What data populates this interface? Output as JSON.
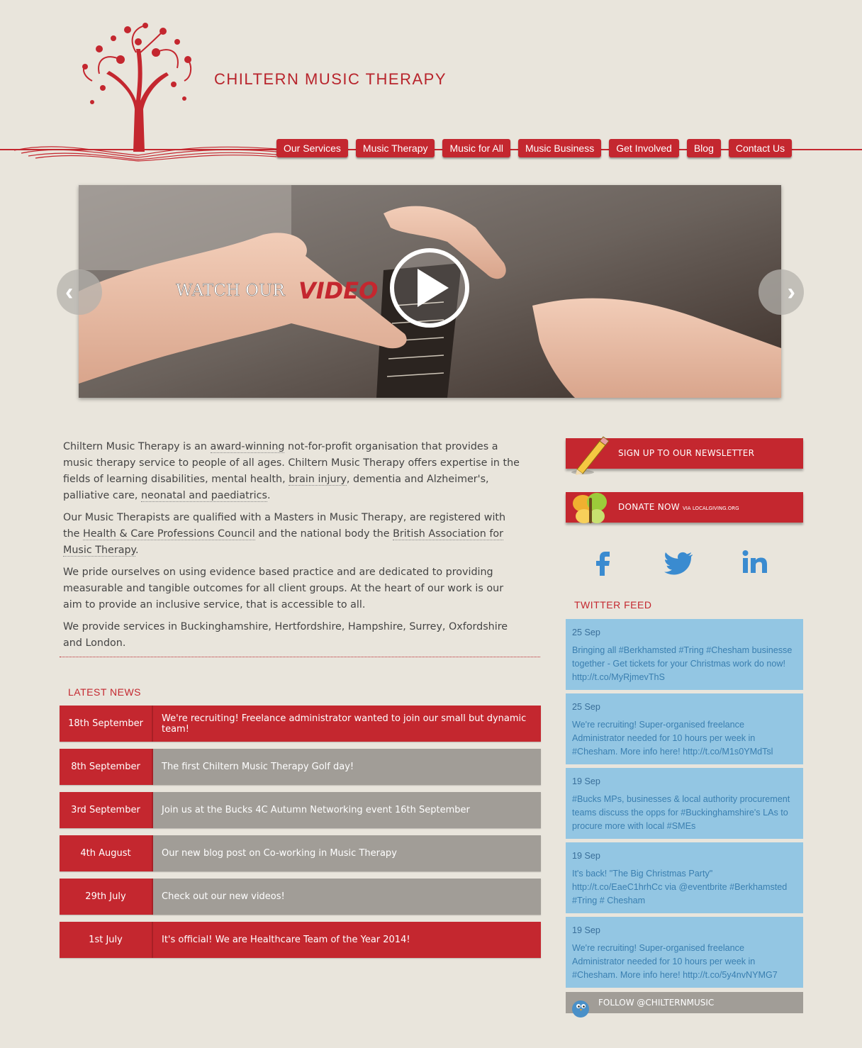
{
  "site": {
    "title": "CHILTERN MUSIC THERAPY"
  },
  "nav": [
    {
      "label": "Our Services"
    },
    {
      "label": "Music Therapy"
    },
    {
      "label": "Music for All"
    },
    {
      "label": "Music Business"
    },
    {
      "label": "Get Involved"
    },
    {
      "label": "Blog"
    },
    {
      "label": "Contact Us"
    }
  ],
  "slider": {
    "watch_label": "WATCH OUR",
    "video_label": "VIDEO",
    "prev": "‹",
    "next": "›"
  },
  "intro": {
    "p1_a": "Chiltern Music Therapy is an ",
    "p1_link1": "award-winning",
    "p1_b": " not-for-profit organisation that provides a music therapy service to people of all ages. Chiltern Music Therapy offers expertise in the fields of learning disabilities, mental health, ",
    "p1_link2": "brain injury",
    "p1_c": ", dementia and Alzheimer's, palliative care, ",
    "p1_link3": "neonatal and paediatrics",
    "p1_d": ".",
    "p2_a": "Our Music Therapists are qualified with a Masters in Music Therapy, are registered with the ",
    "p2_link1": "Health & Care Professions Council",
    "p2_b": " and the national body the ",
    "p2_link2": "British Association for Music Therapy",
    "p2_c": ".",
    "p3": "We pride ourselves on using evidence based practice and are dedicated to providing measurable and tangible outcomes for all client groups. At the heart of our work is our aim to provide an inclusive service, that is accessible to all.",
    "p4": "We provide services in Buckinghamshire, Hertfordshire, Hampshire, Surrey, Oxfordshire and London."
  },
  "news": {
    "heading": "LATEST NEWS",
    "items": [
      {
        "date": "18th September",
        "title": "We're recruiting! Freelance administrator wanted to join our small but dynamic team!"
      },
      {
        "date": "8th September",
        "title": "The first Chiltern Music Therapy Golf day!"
      },
      {
        "date": "3rd September",
        "title": "Join us at the Bucks 4C Autumn Networking event 16th September"
      },
      {
        "date": "4th August",
        "title": "Our new blog post on Co-working in Music Therapy"
      },
      {
        "date": "29th July",
        "title": "Check out our new videos!"
      },
      {
        "date": "1st July",
        "title": "It's official! We are Healthcare Team of the Year 2014!"
      }
    ]
  },
  "sidebar": {
    "newsletter_label": "SIGN UP TO OUR NEWSLETTER",
    "donate_label": "DONATE NOW",
    "donate_sub": "VIA LOCALGIVING.ORG",
    "twitter_heading": "TWITTER FEED",
    "follow_label": "FOLLOW @CHILTERNMUSIC",
    "social": [
      "facebook-icon",
      "twitter-icon",
      "linkedin-icon"
    ]
  },
  "tweets": [
    {
      "date": "25 Sep",
      "text": "Bringing all #Berkhamsted #Tring #Chesham businesse together - Get tickets for your Christmas work do now! http://t.co/MyRjmevThS"
    },
    {
      "date": "25 Sep",
      "text": "We're recruiting! Super-organised freelance Administrator needed for 10 hours per week in #Chesham. More info here! http://t.co/M1s0YMdTsl"
    },
    {
      "date": "19 Sep",
      "text": "#Bucks MPs, businesses & local authority procurement teams discuss the opps for #Buckinghamshire's LAs to procure more with local #SMEs"
    },
    {
      "date": "19 Sep",
      "text": "It's back! \"The Big Christmas Party\" http://t.co/EaeC1hrhCc via @eventbrite #Berkhamsted #Tring # Chesham"
    },
    {
      "date": "19 Sep",
      "text": "We're recruiting! Super-organised freelance Administrator needed for 10 hours per week in #Chesham. More info here! http://t.co/5y4nvNYMG7"
    }
  ],
  "colors": {
    "brand_red": "#c4272f",
    "tweet_bg": "#93c6e3",
    "grey": "#a19d97",
    "bg": "#e9e5dc"
  }
}
